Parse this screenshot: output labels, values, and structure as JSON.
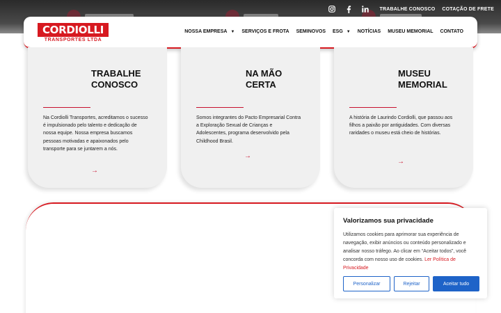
{
  "topbar": {
    "social_icons": [
      "instagram-icon",
      "facebook-icon",
      "linkedin-icon"
    ],
    "links": [
      "TRABALHE CONOSCO",
      "COTAÇÃO DE FRETE"
    ]
  },
  "header": {
    "logo_main": "CORDIOLLI",
    "logo_sub": "TRANSPORTES LTDA",
    "nav": [
      {
        "label": "NOSSA EMPRESA",
        "dropdown": true
      },
      {
        "label": "SERVIÇOS E FROTA",
        "dropdown": false
      },
      {
        "label": "SEMINOVOS",
        "dropdown": false
      },
      {
        "label": "ESG",
        "dropdown": true
      },
      {
        "label": "NOTÍCIAS",
        "dropdown": false
      },
      {
        "label": "MUSEU MEMORIAL",
        "dropdown": false
      },
      {
        "label": "CONTATO",
        "dropdown": false
      }
    ]
  },
  "cards": [
    {
      "title_line1": "TRABALHE",
      "title_line2": "CONOSCO",
      "body": "Na Cordiolli Transportes, acreditamos o sucesso é impulsionado pelo talento e dedicação de nossa equipe. Nossa empresa buscamos pessoas motivadas e apaixonados pelo transporte para se juntarem a nós.",
      "arrow": "→"
    },
    {
      "title_line1": "NA MÃO",
      "title_line2": "CERTA",
      "body": "Somos integrantes do Pacto Empresarial Contra a Exploração Sexual de Crianças e Adolescentes, programa desenvolvido pela Childhood Brasil.",
      "arrow": "→"
    },
    {
      "title_line1": "MUSEU",
      "title_line2": "MEMORIAL",
      "body": "A história de Laurindo Cordiolli, que passou aos filhos a paixão por antiguidades. Com diversas raridades o museu está cheio de histórias.",
      "arrow": "→"
    }
  ],
  "cookie": {
    "title": "Valorizamos sua privacidade",
    "text": "Utilizamos cookies para aprimorar sua experiência de navegação, exibir anúncios ou conteúdo personalizado e analisar nosso tráfego. Ao clicar em “Aceitar todos”, você concorda com nosso uso de cookies. ",
    "link": "Ler Política de Privacidade",
    "buttons": {
      "customize": "Personalizar",
      "reject": "Rejeitar",
      "accept": "Aceitar tudo"
    }
  },
  "colors": {
    "brand_red": "#d71920",
    "button_blue": "#1e63c8",
    "card_bg": "#f0f0f0"
  }
}
